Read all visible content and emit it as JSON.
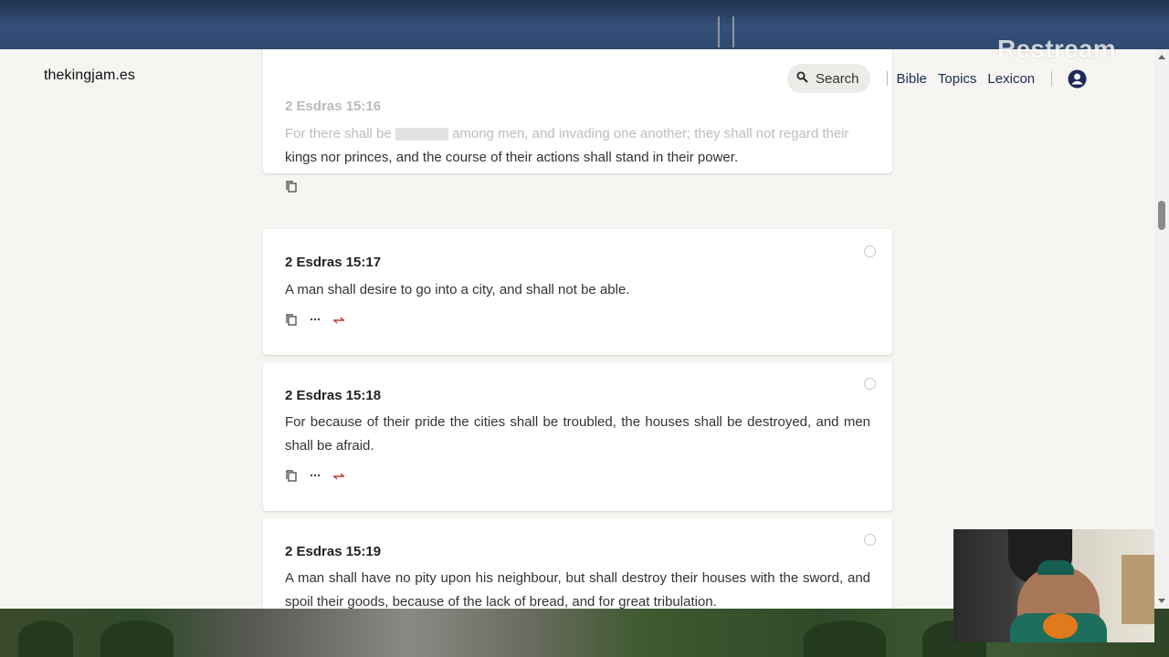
{
  "site": {
    "name": "thekingjam.es"
  },
  "nav": {
    "search_label": "Search",
    "links": [
      "Bible",
      "Topics",
      "Lexicon"
    ]
  },
  "verses": [
    {
      "ref": "2 Esdras 15:16",
      "text_start": "For there shall be",
      "text_mid": "among men, and invading one another; they shall not regard their",
      "text_end": "kings nor princes, and the course of their actions shall stand in their power."
    },
    {
      "ref": "2 Esdras 15:17",
      "text": "A man shall desire to go into a city, and shall not be able."
    },
    {
      "ref": "2 Esdras 15:18",
      "text": "For because of their pride the cities shall be troubled, the houses shall be destroyed, and men shall be afraid."
    },
    {
      "ref": "2 Esdras 15:19",
      "text": "A man shall have no pity upon his neighbour, but shall destroy their houses with the sword, and spoil their goods, because of the lack of bread, and for great tribulation."
    }
  ],
  "overlay": {
    "watermark": "Restream"
  },
  "colors": {
    "nav_link": "#1c2a57",
    "accent_red": "#c0392b",
    "page_bg": "#f6f5f2"
  }
}
